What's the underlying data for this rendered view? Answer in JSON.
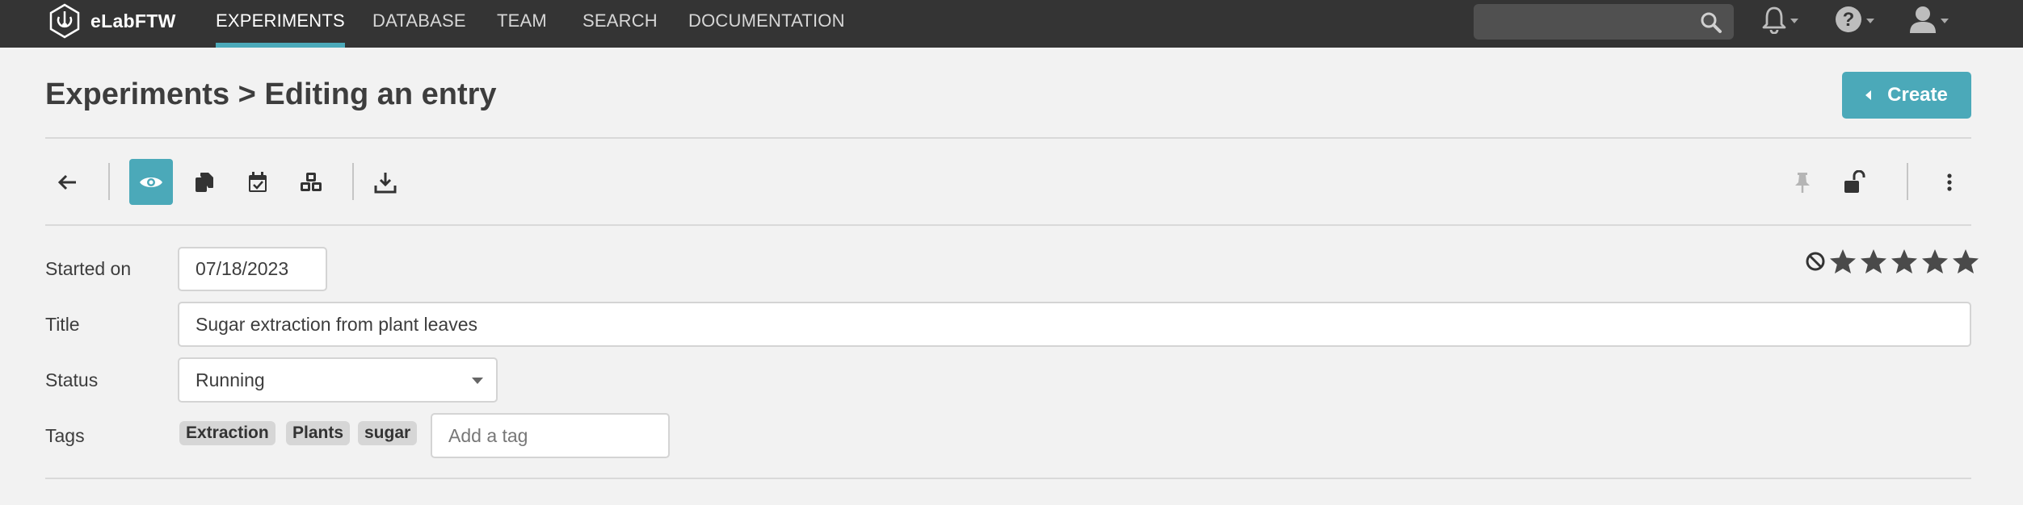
{
  "navbar": {
    "brand": "eLabFTW",
    "links": [
      {
        "label": "EXPERIMENTS",
        "active": true
      },
      {
        "label": "DATABASE",
        "active": false
      },
      {
        "label": "TEAM",
        "active": false
      },
      {
        "label": "SEARCH",
        "active": false
      },
      {
        "label": "DOCUMENTATION",
        "active": false
      }
    ],
    "search_value": "",
    "icons": [
      "bell-icon",
      "help-icon",
      "user-icon"
    ]
  },
  "header": {
    "title": "Experiments > Editing an entry",
    "create_label": "Create"
  },
  "toolbar": {
    "left_icons": [
      "back-arrow-icon",
      "view-eye-icon",
      "duplicate-icon",
      "calendar-icon",
      "share-nodes-icon",
      "download-icon"
    ],
    "right_icons": [
      "pin-icon",
      "lock-open-icon",
      "more-vertical-icon"
    ]
  },
  "form": {
    "started_on": {
      "label": "Started on",
      "value": "07/18/2023"
    },
    "title": {
      "label": "Title",
      "value": "Sugar extraction from plant leaves"
    },
    "status": {
      "label": "Status",
      "value": "Running"
    },
    "tags": {
      "label": "Tags",
      "items": [
        "Extraction",
        "Plants",
        "sugar"
      ],
      "placeholder": "Add a tag"
    }
  },
  "rating": {
    "stars": 5,
    "value": 0
  },
  "colors": {
    "navbar_bg": "#343434",
    "accent": "#4ba9b9",
    "page_bg": "#f2f2f2"
  }
}
